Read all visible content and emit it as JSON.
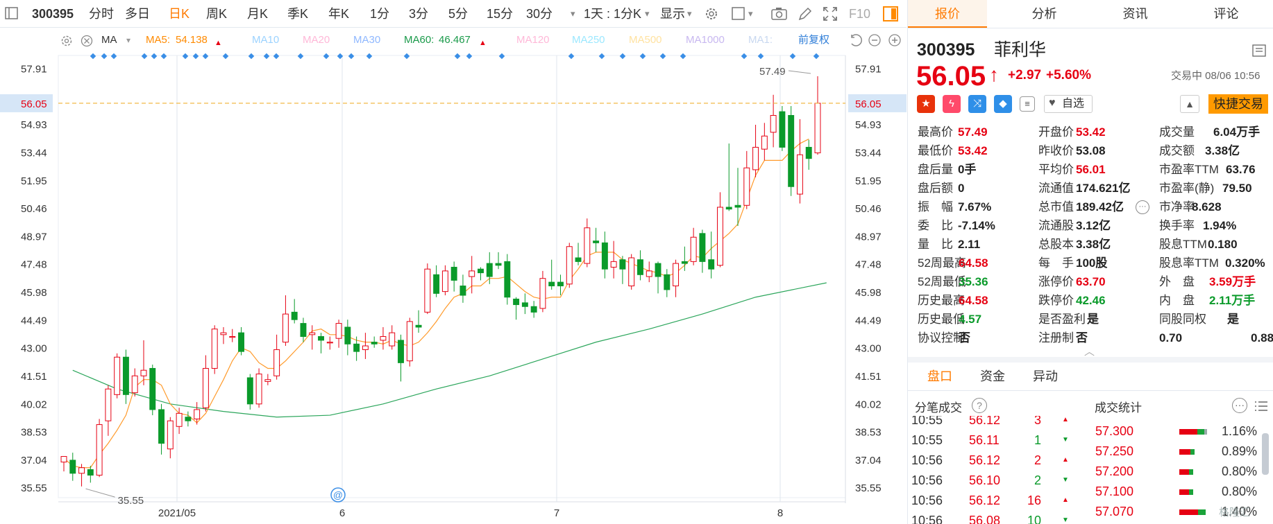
{
  "toolbar": {
    "code": "300395",
    "items": [
      "分时",
      "多日",
      "日K",
      "周K",
      "月K",
      "季K",
      "年K",
      "1分",
      "3分",
      "5分",
      "15分",
      "30分"
    ],
    "active": "日K",
    "period": "1天 : 1分K",
    "display": "显示",
    "f10": "F10"
  },
  "ma": {
    "type": "MA",
    "ma5": "MA5:",
    "ma5_val": "54.138",
    "ma10": "MA10",
    "ma20": "MA20",
    "ma30": "MA30",
    "ma60": "MA60:",
    "ma60_val": "46.467",
    "ma120": "MA120",
    "ma250": "MA250",
    "ma500": "MA500",
    "ma1000": "MA1000",
    "ma_more": "MA1:",
    "adjust": "前复权"
  },
  "axis": {
    "ticks": [
      "57.91",
      "56.05",
      "54.93",
      "53.44",
      "51.95",
      "50.46",
      "48.97",
      "47.48",
      "45.98",
      "44.49",
      "43.00",
      "41.51",
      "40.02",
      "38.53",
      "37.04",
      "35.55"
    ],
    "dates": [
      "2021/05",
      "6",
      "7",
      "8"
    ],
    "high_label": "57.49",
    "low_label": "35.55",
    "current": "56.05",
    "at_icon": "@"
  },
  "chart_data": {
    "type": "candlestick",
    "x_labels": [
      "2021/05",
      "6",
      "7",
      "8"
    ],
    "ylim": [
      35.0,
      58.6
    ],
    "current_price": 56.05,
    "high_annotation": 57.49,
    "low_annotation": 35.55,
    "candles": [
      [
        36.9,
        37.2,
        36.4,
        37.1
      ],
      [
        37.0,
        36.3,
        35.9,
        37.4
      ],
      [
        36.3,
        36.6,
        35.6,
        36.8
      ],
      [
        36.5,
        36.2,
        35.8,
        36.7
      ],
      [
        36.2,
        38.9,
        36.1,
        39.2
      ],
      [
        39.1,
        40.8,
        38.3,
        41.0
      ],
      [
        40.5,
        42.5,
        40.3,
        42.7
      ],
      [
        42.5,
        40.5,
        40.0,
        42.9
      ],
      [
        40.6,
        41.5,
        40.4,
        41.9
      ],
      [
        41.5,
        41.8,
        41.0,
        43.4
      ],
      [
        41.9,
        39.7,
        39.4,
        42.1
      ],
      [
        39.7,
        37.9,
        37.3,
        40.0
      ],
      [
        37.6,
        39.1,
        37.1,
        39.3
      ],
      [
        38.8,
        39.5,
        38.4,
        39.8
      ],
      [
        39.3,
        39.1,
        38.8,
        39.6
      ],
      [
        39.2,
        39.7,
        38.9,
        40.1
      ],
      [
        39.8,
        41.9,
        39.6,
        42.6
      ],
      [
        41.9,
        44.0,
        41.6,
        44.2
      ],
      [
        43.7,
        43.8,
        43.2,
        44.1
      ],
      [
        43.6,
        43.6,
        43.3,
        44.0
      ],
      [
        43.8,
        42.8,
        42.6,
        44.1
      ],
      [
        41.4,
        40.0,
        39.7,
        41.6
      ],
      [
        40.0,
        41.6,
        39.8,
        41.9
      ],
      [
        41.2,
        41.3,
        41.0,
        41.6
      ],
      [
        41.5,
        42.9,
        41.3,
        43.7
      ],
      [
        43.3,
        44.8,
        43.1,
        45.8
      ],
      [
        44.9,
        44.5,
        44.3,
        45.6
      ],
      [
        44.3,
        43.6,
        43.3,
        44.6
      ],
      [
        43.7,
        43.8,
        42.9,
        44.2
      ],
      [
        43.6,
        43.4,
        42.7,
        43.8
      ],
      [
        43.3,
        43.3,
        42.9,
        43.6
      ],
      [
        43.5,
        44.3,
        43.0,
        44.5
      ],
      [
        44.1,
        43.2,
        42.6,
        44.5
      ],
      [
        43.2,
        42.8,
        42.3,
        43.6
      ],
      [
        42.9,
        43.1,
        42.4,
        43.8
      ],
      [
        43.3,
        43.2,
        43.0,
        43.6
      ],
      [
        43.4,
        43.6,
        42.9,
        44.1
      ],
      [
        43.1,
        43.8,
        42.9,
        44.2
      ],
      [
        43.4,
        42.2,
        41.2,
        43.7
      ],
      [
        42.3,
        44.4,
        42.0,
        44.6
      ],
      [
        44.2,
        44.1,
        43.8,
        45.0
      ],
      [
        44.9,
        47.2,
        44.8,
        47.5
      ],
      [
        46.9,
        45.9,
        45.7,
        47.4
      ],
      [
        46.0,
        47.1,
        45.8,
        47.4
      ],
      [
        47.3,
        46.6,
        46.0,
        47.6
      ],
      [
        46.3,
        45.8,
        45.4,
        46.9
      ],
      [
        46.8,
        47.1,
        45.9,
        47.9
      ],
      [
        47.2,
        47.0,
        46.6,
        47.3
      ],
      [
        47.5,
        46.8,
        46.4,
        48.1
      ],
      [
        47.5,
        47.4,
        47.2,
        48.1
      ],
      [
        47.6,
        45.7,
        45.3,
        48.0
      ],
      [
        45.6,
        45.3,
        44.5,
        45.7
      ],
      [
        45.4,
        45.2,
        44.8,
        45.9
      ],
      [
        45.2,
        44.9,
        44.6,
        45.5
      ],
      [
        45.1,
        46.7,
        44.9,
        47.1
      ],
      [
        46.5,
        46.3,
        46.1,
        47.7
      ],
      [
        46.5,
        46.3,
        45.8,
        46.9
      ],
      [
        46.4,
        48.4,
        46.2,
        48.6
      ],
      [
        47.8,
        47.6,
        47.4,
        48.6
      ],
      [
        47.5,
        49.4,
        47.3,
        49.9
      ],
      [
        48.7,
        48.6,
        48.1,
        49.4
      ],
      [
        48.6,
        47.2,
        46.7,
        49.2
      ],
      [
        47.3,
        47.6,
        46.7,
        48.7
      ],
      [
        47.7,
        47.2,
        46.4,
        47.9
      ],
      [
        46.3,
        47.8,
        46.1,
        48.0
      ],
      [
        47.7,
        46.9,
        46.6,
        48.2
      ],
      [
        46.8,
        47.1,
        46.5,
        47.6
      ],
      [
        47.5,
        46.8,
        45.9,
        47.6
      ],
      [
        46.9,
        46.1,
        45.7,
        47.2
      ],
      [
        46.3,
        47.5,
        45.7,
        47.7
      ],
      [
        47.6,
        47.5,
        47.1,
        48.4
      ],
      [
        47.6,
        48.9,
        47.4,
        49.4
      ],
      [
        49.1,
        47.6,
        47.0,
        49.3
      ],
      [
        47.7,
        47.2,
        46.7,
        49.2
      ],
      [
        47.4,
        50.5,
        47.3,
        51.3
      ],
      [
        50.5,
        50.4,
        50.3,
        53.9
      ],
      [
        50.6,
        50.5,
        49.5,
        52.6
      ],
      [
        50.6,
        52.6,
        50.4,
        53.5
      ],
      [
        52.5,
        53.7,
        52.1,
        54.9
      ],
      [
        53.6,
        54.3,
        53.0,
        55.0
      ],
      [
        54.5,
        55.4,
        53.7,
        56.5
      ],
      [
        55.6,
        53.7,
        53.5,
        55.9
      ],
      [
        55.4,
        51.6,
        51.1,
        55.9
      ],
      [
        51.2,
        53.3,
        50.7,
        55.2
      ],
      [
        53.7,
        53.1,
        52.5,
        54.1
      ],
      [
        53.4,
        56.05,
        53.3,
        57.49
      ]
    ],
    "ma5": [
      37.1,
      36.7,
      36.6,
      36.6,
      37.3,
      37.9,
      38.6,
      39.4,
      40.9,
      41.3,
      41.3,
      41.0,
      40.0,
      39.5,
      39.4,
      39.0,
      39.5,
      40.4,
      41.3,
      42.3,
      43.0,
      42.8,
      42.2,
      41.9,
      41.9,
      42.3,
      42.8,
      43.3,
      43.9,
      44.0,
      43.7,
      43.7,
      43.6,
      43.4,
      43.3,
      43.3,
      43.2,
      43.4,
      43.2,
      43.1,
      43.3,
      43.8,
      44.4,
      45.1,
      45.7,
      45.9,
      46.3,
      46.3,
      46.7,
      46.7,
      46.8,
      46.4,
      46.0,
      45.7,
      45.6,
      45.7,
      45.7,
      46.6,
      47.2,
      47.9,
      48.1,
      48.1,
      48.1,
      47.7,
      47.5,
      47.3,
      47.1,
      47.0,
      46.8,
      47.0,
      47.4,
      47.9,
      47.8,
      48.3,
      48.7,
      49.1,
      49.6,
      50.9,
      52.2,
      53.0,
      53.0,
      53.0,
      53.5,
      53.9,
      54.14
    ],
    "ma60_points": [
      [
        1,
        41.8
      ],
      [
        6,
        40.8
      ],
      [
        12,
        40.0
      ],
      [
        18,
        39.6
      ],
      [
        24,
        39.3
      ],
      [
        30,
        39.4
      ],
      [
        36,
        40.0
      ],
      [
        42,
        40.8
      ],
      [
        48,
        41.5
      ],
      [
        54,
        42.4
      ],
      [
        60,
        43.3
      ],
      [
        66,
        44.0
      ],
      [
        72,
        44.8
      ],
      [
        78,
        45.7
      ],
      [
        86,
        46.467
      ]
    ]
  },
  "quote": {
    "tabs": [
      "报价",
      "分析",
      "资讯",
      "评论"
    ],
    "code": "300395",
    "name": "菲利华",
    "price": "56.05",
    "arrow": "↑",
    "change": "+2.97",
    "pct": "+5.60%",
    "status": "交易中 08/06 10:56",
    "watch": "自选",
    "quick_trade": "快捷交易",
    "rows": [
      [
        [
          "最高价",
          "57.49",
          "red"
        ],
        [
          "开盘价",
          "53.42",
          "red"
        ],
        [
          "成交量",
          "6.04万手",
          "dark"
        ]
      ],
      [
        [
          "最低价",
          "53.42",
          "red"
        ],
        [
          "昨收价",
          "53.08",
          "dark"
        ],
        [
          "成交额",
          "3.38亿",
          "dark"
        ]
      ],
      [
        [
          "盘后量",
          "0手",
          "dark"
        ],
        [
          "平均价",
          "56.01",
          "red"
        ],
        [
          "市盈率TTM",
          "63.76",
          "dark"
        ]
      ],
      [
        [
          "盘后额",
          "0",
          "dark"
        ],
        [
          "流通值",
          "174.621亿",
          "dark"
        ],
        [
          "市盈率(静)",
          "79.50",
          "dark"
        ]
      ],
      [
        [
          "振　幅",
          "7.67%",
          "dark"
        ],
        [
          "总市值",
          "189.42亿",
          "dark"
        ],
        [
          "市净率",
          "8.628",
          "dark"
        ]
      ],
      [
        [
          "委　比",
          "-7.14%",
          "dark"
        ],
        [
          "流通股",
          "3.12亿",
          "dark"
        ],
        [
          "换手率",
          "1.94%",
          "dark"
        ]
      ],
      [
        [
          "量　比",
          "2.11",
          "dark"
        ],
        [
          "总股本",
          "3.38亿",
          "dark"
        ],
        [
          "股息TTM",
          "0.180",
          "dark"
        ]
      ],
      [
        [
          "52周最高",
          "64.58",
          "red"
        ],
        [
          "每　手",
          "100股",
          "dark"
        ],
        [
          "股息率TTM",
          "0.320%",
          "dark"
        ]
      ],
      [
        [
          "52周最低",
          "35.36",
          "green"
        ],
        [
          "涨停价",
          "63.70",
          "red"
        ],
        [
          "外　盘",
          "3.59万手",
          "red"
        ]
      ],
      [
        [
          "历史最高",
          "64.58",
          "red"
        ],
        [
          "跌停价",
          "42.46",
          "green"
        ],
        [
          "内　盘",
          "2.11万手",
          "green"
        ]
      ],
      [
        [
          "历史最低",
          "4.57",
          "green"
        ],
        [
          "是否盈利",
          "是",
          "dark"
        ],
        [
          "同股同权",
          "是",
          "dark"
        ]
      ],
      [
        [
          "协议控制",
          "否",
          "dark"
        ],
        [
          "注册制",
          "否",
          "dark"
        ],
        [
          "0.70",
          "0.88",
          "dark"
        ]
      ]
    ]
  },
  "lower": {
    "tabs": [
      "盘口",
      "资金",
      "异动"
    ],
    "ticks_title": "分笔成交",
    "stats_title": "成交统计",
    "ticks": [
      [
        "10:55",
        "56.12",
        "3",
        "up"
      ],
      [
        "10:55",
        "56.11",
        "1",
        "down"
      ],
      [
        "10:56",
        "56.12",
        "2",
        "up"
      ],
      [
        "10:56",
        "56.10",
        "2",
        "down"
      ],
      [
        "10:56",
        "56.12",
        "16",
        "up"
      ],
      [
        "10:56",
        "56.08",
        "10",
        "down"
      ]
    ],
    "stats": [
      [
        "57.300",
        "1.16%",
        0.9
      ],
      [
        "57.250",
        "0.89%",
        0.55
      ],
      [
        "57.200",
        "0.80%",
        0.5
      ],
      [
        "57.100",
        "0.80%",
        0.5
      ],
      [
        "57.070",
        "1.40%",
        0.95
      ]
    ],
    "watermark": "格隆汇"
  }
}
